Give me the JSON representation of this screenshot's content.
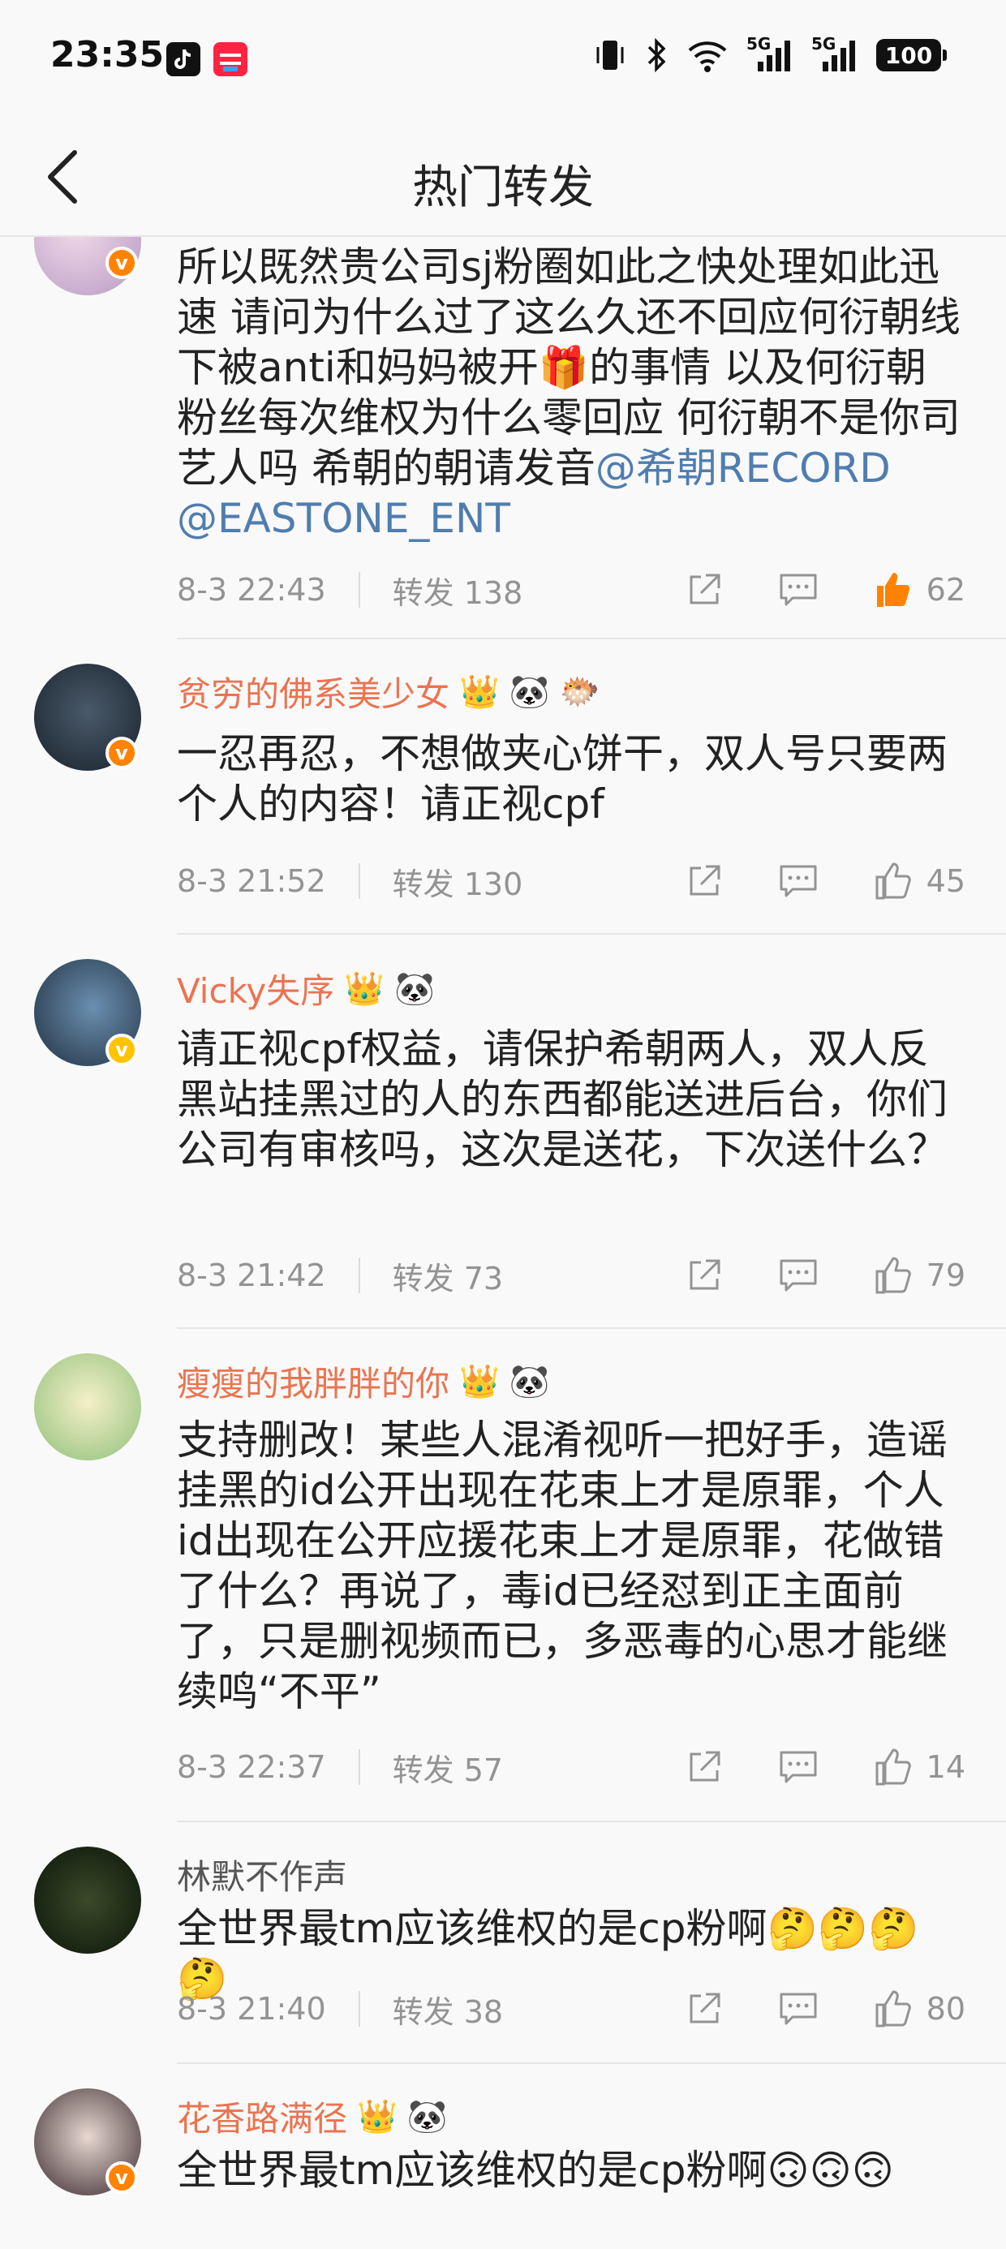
{
  "status_bar": {
    "time": "23:35",
    "battery": "100",
    "net1": "5G",
    "net2": "5G"
  },
  "header": {
    "title": "热门转发",
    "back_icon": "chevron-left-icon"
  },
  "comments": [
    {
      "username": "",
      "text_plain": "所以既然贵公司sj粉圈如此之快处理如此迅速 请问为什么过了这么久还不回应何衍朝线下被anti和妈妈被开🎁的事情 以及何衍朝粉丝每次维权为什么零回应 何衍朝不是你司艺人吗 希朝的朝请发音",
      "mention": "@希朝RECORD @EASTONE_ENT",
      "date": "8-3 22:43",
      "repost": "转发 138",
      "likes": "62",
      "liked": true
    },
    {
      "username": "贫穷的佛系美少女",
      "text": "一忍再忍，不想做夹心饼干，双人号只要两个人的内容！请正视cpf",
      "date": "8-3 21:52",
      "repost": "转发 130",
      "likes": "45"
    },
    {
      "username": "Vicky失序",
      "text": "请正视cpf权益，请保护希朝两人，双人反黑站挂黑过的人的东西都能送进后台，你们公司有审核吗，这次是送花，下次送什么？",
      "date": "8-3 21:42",
      "repost": "转发 73",
      "likes": "79"
    },
    {
      "username": "瘦瘦的我胖胖的你",
      "text": "支持删改！某些人混淆视听一把好手，造谣挂黑的id公开出现在花束上才是原罪，个人id出现在公开应援花束上才是原罪，花做错了什么？再说了，毒id已经怼到正主面前了，只是删视频而已，多恶毒的心思才能继续鸣“不平”",
      "date": "8-3 22:37",
      "repost": "转发 57",
      "likes": "14"
    },
    {
      "username": "林默不作声",
      "text": "全世界最tm应该维权的是cp粉啊🤔🤔🤔🤔",
      "date": "8-3 21:40",
      "repost": "转发 38",
      "likes": "80"
    },
    {
      "username": "花香路满径",
      "text": "全世界最tm应该维权的是cp粉啊🙃🙃🙃"
    }
  ],
  "badges": {
    "crown": "👑",
    "panda": "🐼",
    "pufferfish": "🐡",
    "verify_mark": "v"
  },
  "colors": {
    "username": "#eb7350",
    "mention": "#507daf",
    "liked": "#ff8200",
    "meta": "#939393"
  }
}
